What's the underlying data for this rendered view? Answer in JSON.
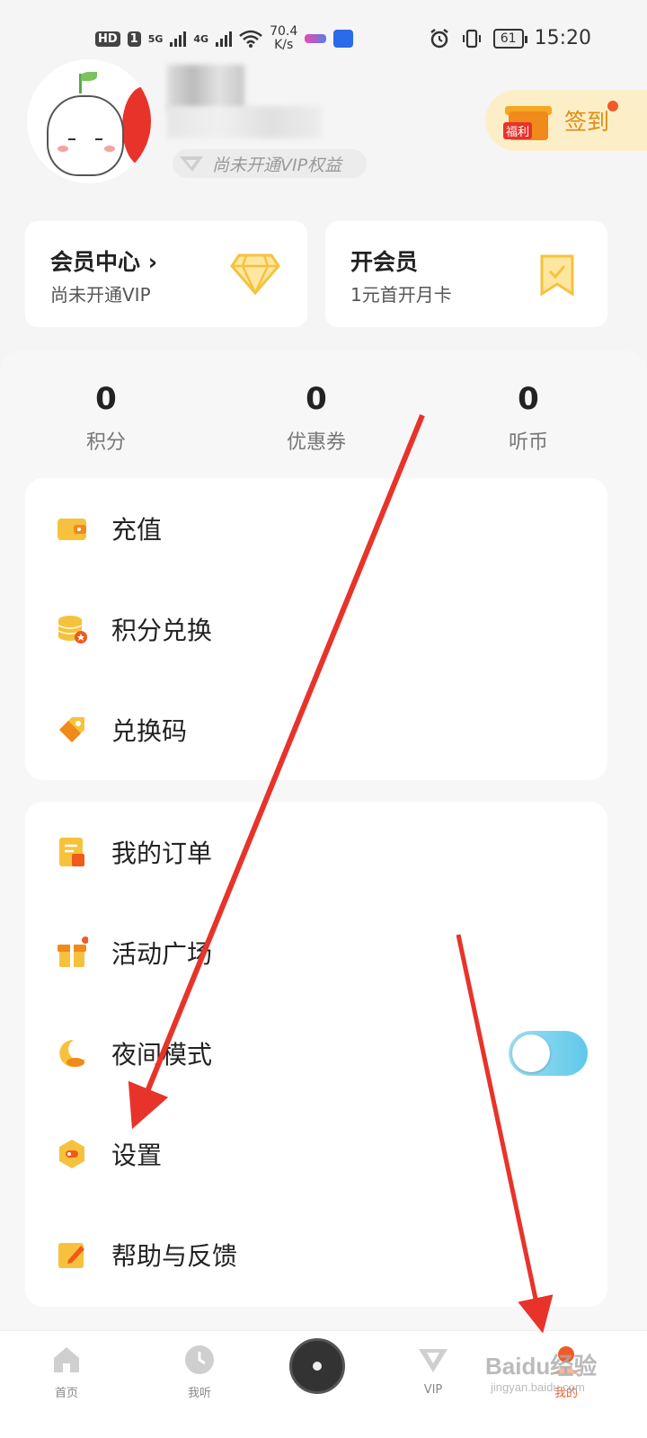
{
  "status_bar": {
    "hd_badge": "HD",
    "sim_badge": "1",
    "network_5g": "5G",
    "network_4g": "4G",
    "speed_value": "70.4",
    "speed_unit": "K/s",
    "battery": "61",
    "time": "15:20"
  },
  "profile": {
    "vip_status": "尚未开通VIP权益",
    "checkin_label": "签到",
    "checkin_badge": "福利"
  },
  "member_cards": {
    "center_title": "会员中心",
    "center_sub": "尚未开通VIP",
    "open_title": "开会员",
    "open_sub": "1元首开月卡"
  },
  "stats": [
    {
      "value": "0",
      "label": "积分"
    },
    {
      "value": "0",
      "label": "优惠券"
    },
    {
      "value": "0",
      "label": "听币"
    }
  ],
  "menu_group_1": [
    {
      "label": "充值",
      "icon": "wallet-icon"
    },
    {
      "label": "积分兑换",
      "icon": "coin-stack-icon"
    },
    {
      "label": "兑换码",
      "icon": "tag-icon"
    }
  ],
  "menu_group_2": [
    {
      "label": "我的订单",
      "icon": "order-icon"
    },
    {
      "label": "活动广场",
      "icon": "gift-icon"
    },
    {
      "label": "夜间模式",
      "icon": "moon-icon",
      "toggle_on": false
    },
    {
      "label": "设置",
      "icon": "settings-icon"
    },
    {
      "label": "帮助与反馈",
      "icon": "edit-icon"
    }
  ],
  "tab_bar": [
    {
      "label": "首页",
      "icon": "home-icon"
    },
    {
      "label": "我听",
      "icon": "clock-icon"
    },
    {
      "label": "",
      "icon": "disc-icon"
    },
    {
      "label": "VIP",
      "icon": "vip-icon"
    },
    {
      "label": "我的",
      "icon": "user-icon",
      "active": true
    }
  ],
  "colors": {
    "accent": "#f5a623",
    "active_tab": "#f15a29",
    "arrow": "#e8332b"
  },
  "watermark": {
    "brand": "Baidu经验",
    "url": "jingyan.baidu.com"
  }
}
